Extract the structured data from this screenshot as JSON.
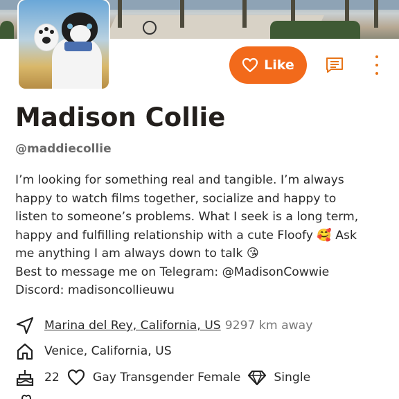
{
  "profile": {
    "name": "Madison Collie",
    "handle": "@maddiecollie",
    "bio_lines": [
      "I’m looking for something real and tangible. I’m always",
      "happy to watch films together, socialize and happy to",
      "listen to someone’s problems. What I seek is a long term,",
      "happy and fulfilling relationship with a cute Floofy 🥰 Ask",
      "me anything I am always down to talk 😘",
      "Best to message me on Telegram: @MadisonCowwie",
      "Discord: madisoncollieuwu"
    ]
  },
  "actions": {
    "like_label": "Like",
    "like_icon": "heart-outline-icon",
    "message_icon": "message-icon",
    "more_icon": "more-vertical-icon",
    "accent_color": "#f26a1b"
  },
  "details": {
    "location": "Marina del Rey, California, US",
    "distance": "9297 km away",
    "hometown": "Venice, California, US",
    "age": "22",
    "orientation": "Gay Transgender Female",
    "relationship": "Single"
  }
}
